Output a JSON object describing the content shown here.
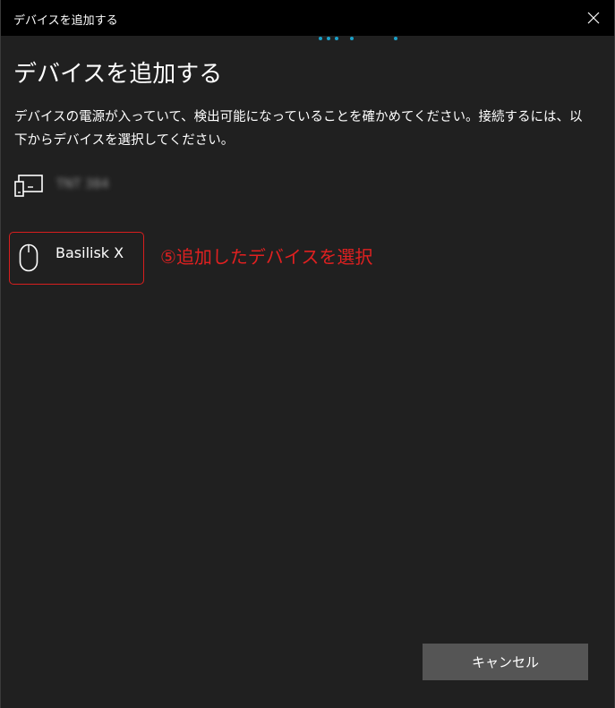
{
  "window": {
    "title": "デバイスを追加する"
  },
  "page": {
    "heading": "デバイスを追加する",
    "description": "デバイスの電源が入っていて、検出可能になっていることを確かめてください。接続するには、以下からデバイスを選択してください。"
  },
  "devices": [
    {
      "name": "TNT 384",
      "icon": "display-device-icon",
      "blurred": true
    },
    {
      "name": "Basilisk X",
      "icon": "mouse-icon",
      "selected": true
    }
  ],
  "annotation": {
    "text": "⑤追加したデバイスを選択",
    "color": "#e02020"
  },
  "footer": {
    "cancel_label": "キャンセル"
  },
  "colors": {
    "accent": "#1ba1c9",
    "highlight_border": "#d81e1e",
    "background": "#202020",
    "titlebar": "#000000",
    "button": "#555555"
  }
}
